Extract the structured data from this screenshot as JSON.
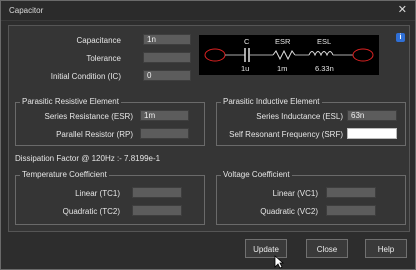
{
  "window": {
    "title": "Capacitor",
    "close_glyph": "✕"
  },
  "main": {
    "capacitance": {
      "label": "Capacitance",
      "value": "1n"
    },
    "tolerance": {
      "label": "Tolerance",
      "value": ""
    },
    "initial_condition": {
      "label": "Initial Condition (IC)",
      "value": "0"
    }
  },
  "schematic": {
    "c_label": "C",
    "esr_label": "ESR",
    "esl_label": "ESL",
    "c_value": "1u",
    "esr_value": "1m",
    "esl_value": "6.33n",
    "info_glyph": "i"
  },
  "parasitic_resistive": {
    "title": "Parasitic Resistive Element",
    "esr": {
      "label": "Series Resistance (ESR)",
      "value": "1m"
    },
    "rp": {
      "label": "Parallel Resistor (RP)",
      "value": ""
    }
  },
  "parasitic_inductive": {
    "title": "Parasitic Inductive Element",
    "esl": {
      "label": "Series Inductance (ESL)",
      "value": "63n"
    },
    "srf": {
      "label": "Self Resonant Frequency (SRF)",
      "value": ""
    }
  },
  "dissipation_factor": "Dissipation Factor @ 120Hz :- 7.8199e-1",
  "temperature_coefficient": {
    "title": "Temperature Coefficient",
    "linear": {
      "label": "Linear (TC1)",
      "value": ""
    },
    "quadratic": {
      "label": "Quadratic (TC2)",
      "value": ""
    }
  },
  "voltage_coefficient": {
    "title": "Voltage Coefficient",
    "linear": {
      "label": "Linear (VC1)",
      "value": ""
    },
    "quadratic": {
      "label": "Quadratic (VC2)",
      "value": ""
    }
  },
  "buttons": {
    "update": "Update",
    "close": "Close",
    "help": "Help"
  }
}
